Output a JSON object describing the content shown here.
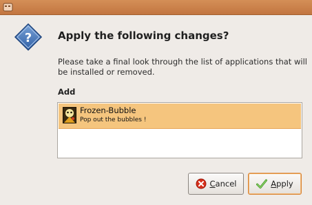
{
  "window": {
    "app_icon": "package-manager-icon",
    "accent": "#c98247"
  },
  "dialog": {
    "icon": "question-icon",
    "heading": "Apply the following changes?",
    "description": "Please take a final look through the list of applications that will be installed or removed.",
    "section_label": "Add",
    "items": [
      {
        "icon": "frozen-bubble-icon",
        "name": "Frozen-Bubble",
        "summary": "Pop out the bubbles !",
        "selected": true
      }
    ],
    "buttons": {
      "cancel": {
        "mnemonic": "C",
        "rest": "ancel",
        "icon": "cancel-icon"
      },
      "apply": {
        "mnemonic": "A",
        "rest": "pply",
        "icon": "apply-check-icon"
      }
    },
    "colors": {
      "selection": "#f5c57e",
      "default_button_border": "#d98333"
    }
  }
}
